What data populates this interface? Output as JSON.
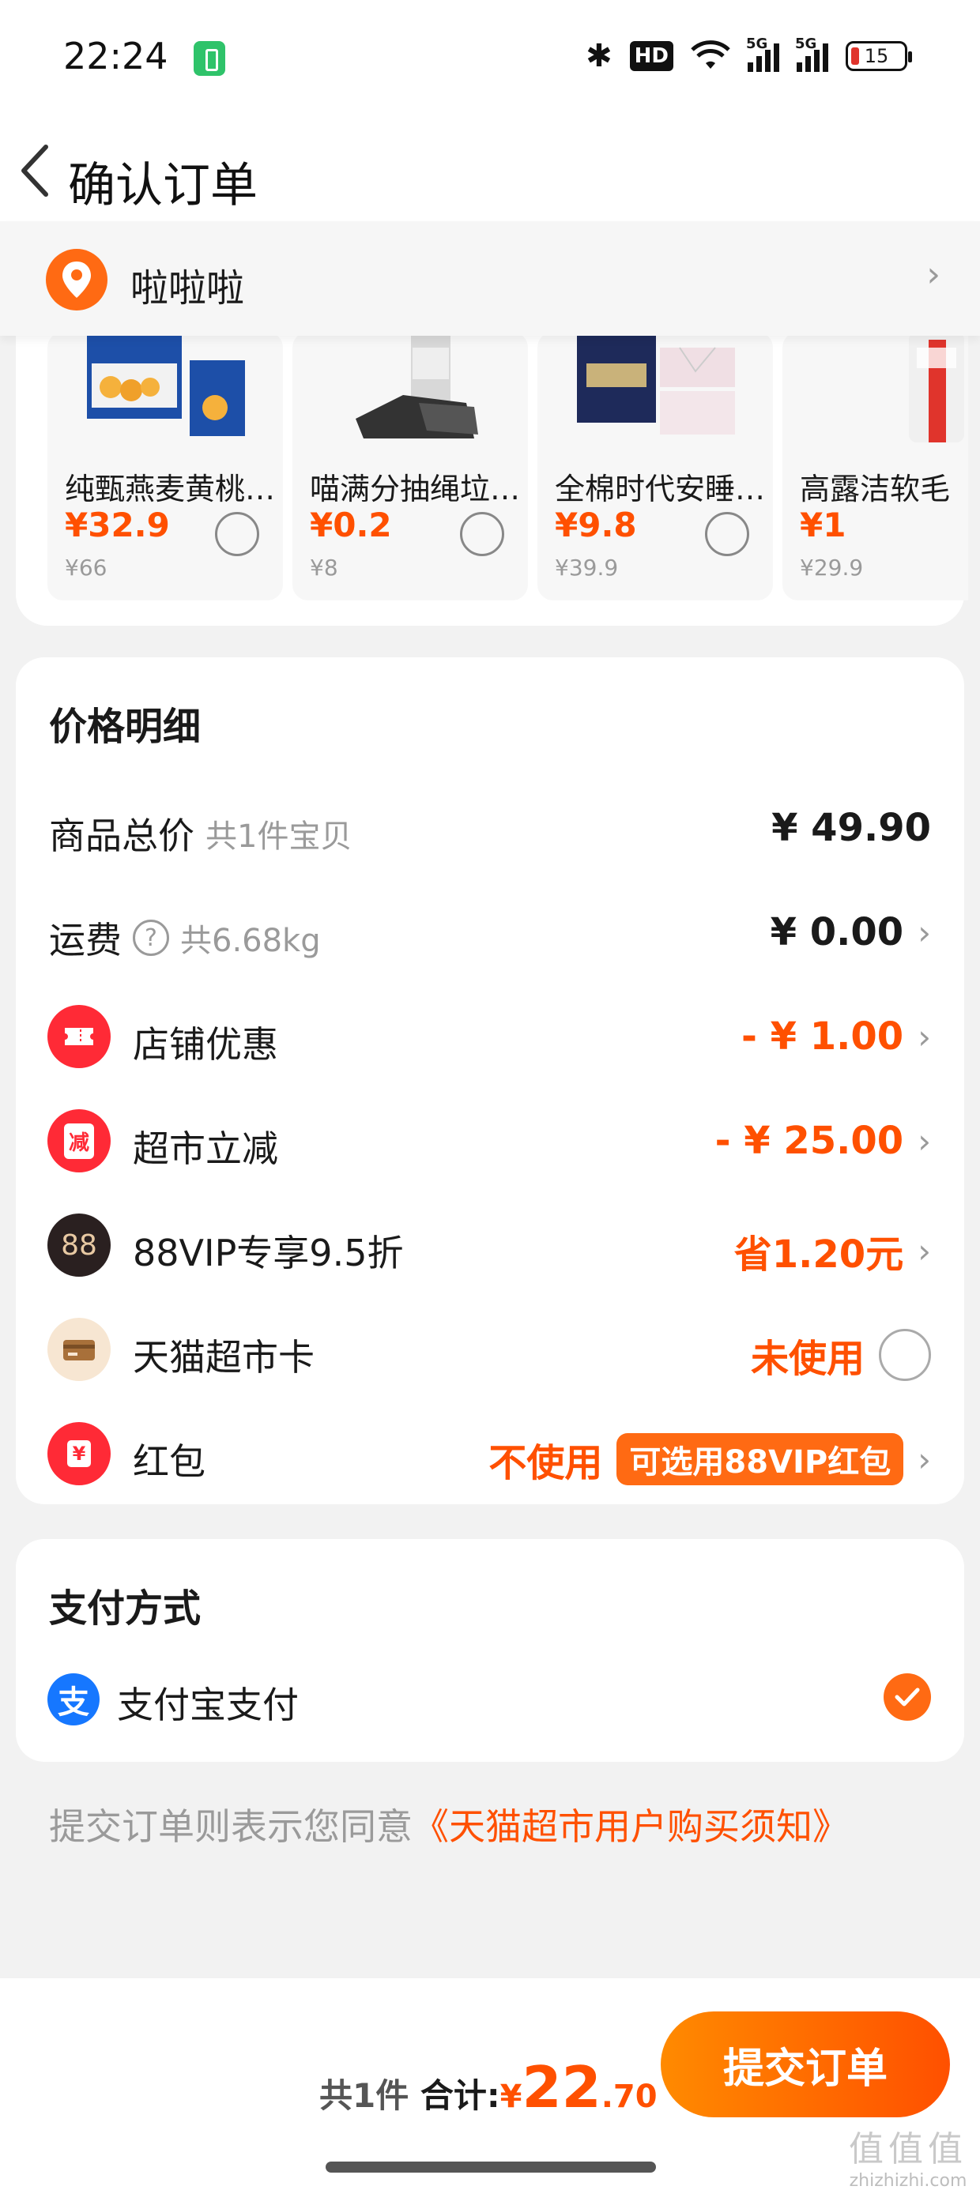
{
  "status_bar": {
    "time": "22:24",
    "hd": "HD",
    "signal1": "5G",
    "signal2": "5G",
    "battery": "15"
  },
  "nav": {
    "title": "确认订单",
    "back_icon": "chevron-left-icon"
  },
  "address": {
    "name": "啦啦啦",
    "icon": "location-pin-icon"
  },
  "products": [
    {
      "name": "纯甄燕麦黄桃…",
      "price": "¥32.9",
      "original": "¥66"
    },
    {
      "name": "喵满分抽绳垃…",
      "price": "¥0.2",
      "original": "¥8"
    },
    {
      "name": "全棉时代安睡…",
      "price": "¥9.8",
      "original": "¥39.9"
    },
    {
      "name": "高露洁软毛",
      "price": "¥1",
      "original": "¥29.9"
    }
  ],
  "price_detail": {
    "title": "价格明细",
    "goods_total": {
      "label": "商品总价",
      "sub": "共1件宝贝",
      "value": "¥ 49.90"
    },
    "shipping": {
      "label": "运费",
      "sub": "共6.68kg",
      "value": "¥ 0.00"
    },
    "shop_discount": {
      "label": "店铺优惠",
      "value": "- ¥ 1.00"
    },
    "market_cut": {
      "label": "超市立减",
      "value": "- ¥ 25.00",
      "icon_text": "减"
    },
    "vip": {
      "label": "88VIP专享9.5折",
      "value": "省1.20元",
      "icon_text": "88"
    },
    "market_card": {
      "label": "天猫超市卡",
      "value": "未使用"
    },
    "red_packet": {
      "label": "红包",
      "value": "不使用",
      "tag": "可选用88VIP红包",
      "icon_text": "¥"
    }
  },
  "payment": {
    "title": "支付方式",
    "method": "支付宝支付",
    "icon_text": "支"
  },
  "agreement": {
    "text": "提交订单则表示您同意",
    "link": "《天猫超市用户购买须知》"
  },
  "bottom": {
    "count": "共1件",
    "total_label": "合计:",
    "currency": "¥",
    "total_int": "22",
    "total_dec": ".70",
    "submit": "提交订单"
  },
  "watermark": {
    "big": "值值值",
    "small": "zhizhizhi.com"
  },
  "colors": {
    "accent": "#ff5000",
    "accent_light": "#ff8a00",
    "alipay": "#1677ff"
  }
}
